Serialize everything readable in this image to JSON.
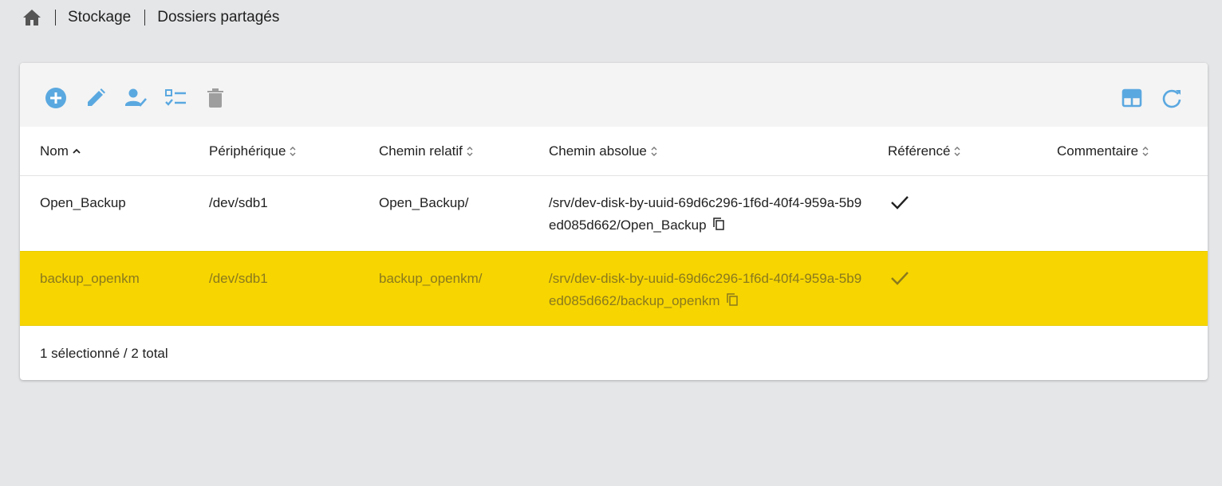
{
  "breadcrumb": {
    "home_icon": "home-icon",
    "items": [
      "Stockage",
      "Dossiers partagés"
    ]
  },
  "toolbar": {
    "left_icons": [
      "add-circle-icon",
      "edit-pencil-icon",
      "user-check-icon",
      "checklist-icon",
      "trash-icon"
    ],
    "right_icons": [
      "table-columns-icon",
      "refresh-icon"
    ],
    "accent_color": "#5aa8e0",
    "disabled_color": "#9e9e9e"
  },
  "table": {
    "columns": [
      {
        "label": "Nom",
        "sort": "ascending"
      },
      {
        "label": "Périphérique",
        "sort": "none"
      },
      {
        "label": "Chemin relatif",
        "sort": "none"
      },
      {
        "label": "Chemin absolue",
        "sort": "none"
      },
      {
        "label": "Référencé",
        "sort": "none"
      },
      {
        "label": "Commentaire",
        "sort": "none"
      }
    ],
    "rows": [
      {
        "name": "Open_Backup",
        "device": "/dev/sdb1",
        "relative_path": "Open_Backup/",
        "absolute_path": "/srv/dev-disk-by-uuid-69d6c296-1f6d-40f4-959a-5b9ed085d662/Open_Backup",
        "referenced": true,
        "comment": "",
        "selected": false
      },
      {
        "name": "backup_openkm",
        "device": "/dev/sdb1",
        "relative_path": "backup_openkm/",
        "absolute_path": "/srv/dev-disk-by-uuid-69d6c296-1f6d-40f4-959a-5b9ed085d662/backup_openkm",
        "referenced": true,
        "comment": "",
        "selected": true
      }
    ],
    "selection_color": "#f7d500"
  },
  "footer": {
    "status": "1 sélectionné / 2 total"
  }
}
